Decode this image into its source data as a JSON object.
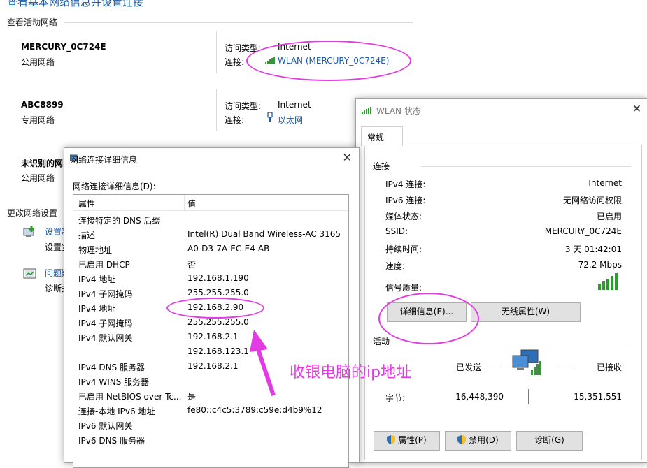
{
  "background": {
    "heading": "查看基本网络信息并设置连接",
    "active_networks_label": "查看活动网络",
    "change_settings_label": "更改网络设置",
    "networks": [
      {
        "name": "MERCURY_0C724E",
        "type": "公用网络",
        "access_label": "访问类型:",
        "access_value": "Internet",
        "connection_label": "连接:",
        "connection_value": "WLAN (MERCURY_0C724E)"
      },
      {
        "name": "ABC8899",
        "type": "专用网络",
        "access_label": "访问类型:",
        "access_value": "Internet",
        "connection_label": "连接:",
        "connection_value": "以太网"
      },
      {
        "name": "未识别的网",
        "type": "公用网络"
      }
    ],
    "settings_items": [
      {
        "title": "设置新",
        "subtitle": "设置宽"
      },
      {
        "title": "问题疑",
        "subtitle": "诊断并"
      }
    ]
  },
  "details_dialog": {
    "title": "网络连接详细信息",
    "list_label": "网络连接详细信息(D):",
    "columns": [
      "属性",
      "值"
    ],
    "rows": [
      [
        "连接特定的 DNS 后缀",
        ""
      ],
      [
        "描述",
        "Intel(R) Dual Band Wireless-AC 3165"
      ],
      [
        "物理地址",
        "A0-D3-7A-EC-E4-AB"
      ],
      [
        "已启用 DHCP",
        "否"
      ],
      [
        "IPv4 地址",
        "192.168.1.190"
      ],
      [
        "IPv4 子网掩码",
        "255.255.255.0"
      ],
      [
        "IPv4 地址",
        "192.168.2.90"
      ],
      [
        "IPv4 子网掩码",
        "255.255.255.0"
      ],
      [
        "IPv4 默认网关",
        "192.168.2.1"
      ],
      [
        "",
        "192.168.123.1"
      ],
      [
        "IPv4 DNS 服务器",
        "192.168.2.1"
      ],
      [
        "IPv4 WINS 服务器",
        ""
      ],
      [
        "已启用 NetBIOS over Tc...",
        "是"
      ],
      [
        "连接-本地 IPv6 地址",
        "fe80::c4c5:3789:c59e:d4b9%12"
      ],
      [
        "IPv6 默认网关",
        ""
      ],
      [
        "IPv6 DNS 服务器",
        ""
      ]
    ]
  },
  "wlan_status": {
    "title": "WLAN 状态",
    "tab": "常规",
    "connection_section": "连接",
    "fields": [
      {
        "label": "IPv4 连接:",
        "value": "Internet"
      },
      {
        "label": "IPv6 连接:",
        "value": "无网络访问权限"
      },
      {
        "label": "媒体状态:",
        "value": "已启用"
      },
      {
        "label": "SSID:",
        "value": "MERCURY_0C724E"
      },
      {
        "label": "持续时间:",
        "value": "3 天 01:42:01"
      },
      {
        "label": "速度:",
        "value": "72.2 Mbps"
      }
    ],
    "signal_label": "信号质量:",
    "details_button": "详细信息(E)...",
    "wireless_props_button": "无线属性(W)",
    "activity_section": "活动",
    "sent_label": "已发送",
    "received_label": "已接收",
    "bytes_label": "字节:",
    "bytes_sent": "16,448,390",
    "bytes_received": "15,351,551",
    "properties_button": "属性(P)",
    "disable_button": "禁用(D)",
    "diagnose_button": "诊断(G)"
  },
  "annotation": {
    "text": "收银电脑的ip地址",
    "color": "#e23be3"
  },
  "colors": {
    "link": "#1e5aa8",
    "signal": "#2a9d2a",
    "annotation": "#e23be3"
  }
}
